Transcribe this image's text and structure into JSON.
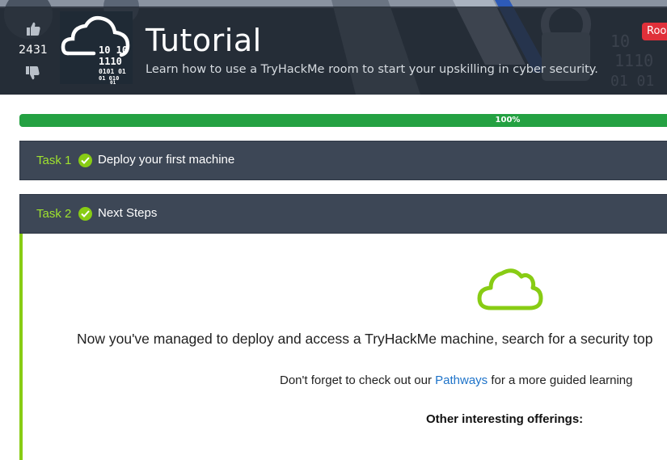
{
  "room": {
    "title": "Tutorial",
    "subtitle": "Learn how to use a TryHackMe room to start your upskilling in cyber security.",
    "badge": "Roo",
    "vote_count": "2431",
    "icon_text": [
      "10 10",
      "1110",
      "0101 01",
      "01 010",
      "01"
    ]
  },
  "progress": {
    "label": "100%",
    "fraction": 1.0
  },
  "tasks": [
    {
      "number": "Task 1",
      "title": "Deploy your first machine",
      "completed": true
    },
    {
      "number": "Task 2",
      "title": "Next Steps",
      "completed": true
    }
  ],
  "task_body": {
    "line1": "Now you've managed to deploy and access a TryHackMe machine, search for a security top",
    "line2_before": "Don't forget to check out our ",
    "line2_link": "Pathways",
    "line2_after": " for a more guided learning",
    "offerings_heading": "Other interesting offerings:"
  },
  "colors": {
    "banner": "#27303a",
    "task_header": "#3d4756",
    "task_number": "#9fe22e",
    "check": "#88cc14",
    "progress": "#24a142",
    "link": "#1e73c9",
    "badge": "#e0303a"
  },
  "icons": [
    "thumbs-up-icon",
    "thumbs-down-icon",
    "cloud-binary-icon",
    "check-circle-icon",
    "cloud-outline-icon"
  ]
}
